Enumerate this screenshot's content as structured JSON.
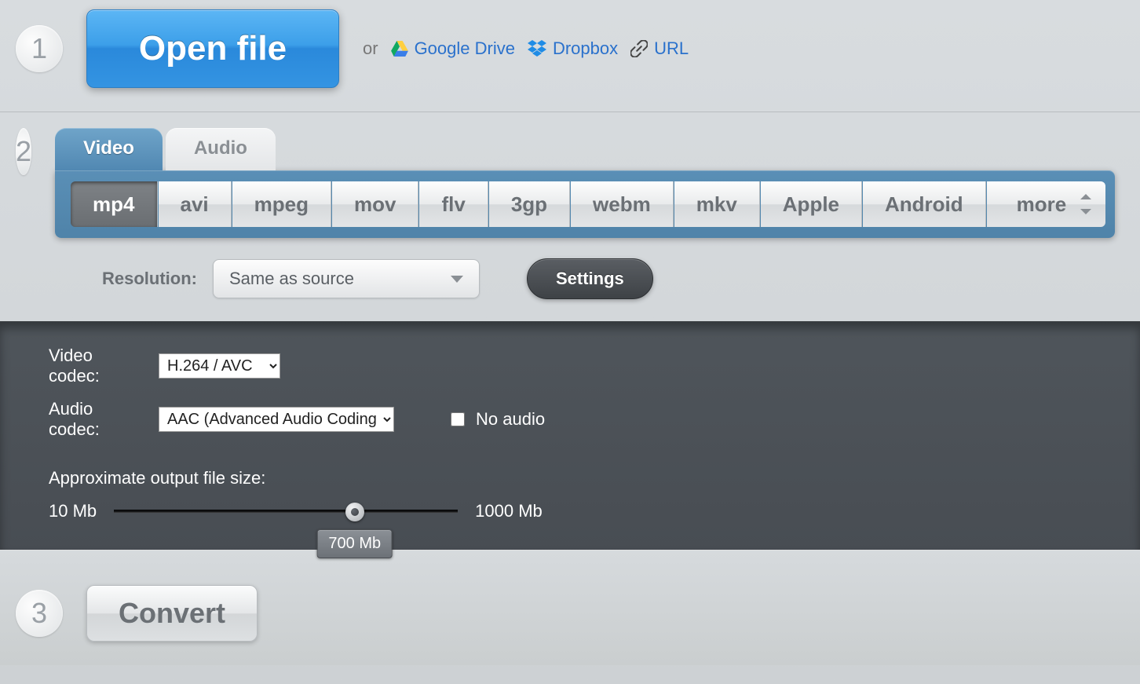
{
  "step1": {
    "number": "1",
    "open_button": "Open file",
    "or": "or",
    "links": {
      "gdrive": "Google Drive",
      "dropbox": "Dropbox",
      "url": "URL"
    }
  },
  "step2": {
    "number": "2",
    "tabs": {
      "video": "Video",
      "audio": "Audio"
    },
    "formats": {
      "mp4": "mp4",
      "avi": "avi",
      "mpeg": "mpeg",
      "mov": "mov",
      "flv": "flv",
      "3gp": "3gp",
      "webm": "webm",
      "mkv": "mkv",
      "apple": "Apple",
      "android": "Android",
      "more": "more"
    },
    "resolution_label": "Resolution:",
    "resolution_value": "Same as source",
    "settings_button": "Settings"
  },
  "settings": {
    "video_codec_label": "Video codec:",
    "video_codec_value": "H.264 / AVC",
    "audio_codec_label": "Audio codec:",
    "audio_codec_value": "AAC (Advanced Audio Coding)",
    "no_audio": "No audio",
    "size_label": "Approximate output file size:",
    "size_min": "10 Mb",
    "size_max": "1000 Mb",
    "size_value": "700 Mb"
  },
  "step3": {
    "number": "3",
    "convert_button": "Convert"
  }
}
